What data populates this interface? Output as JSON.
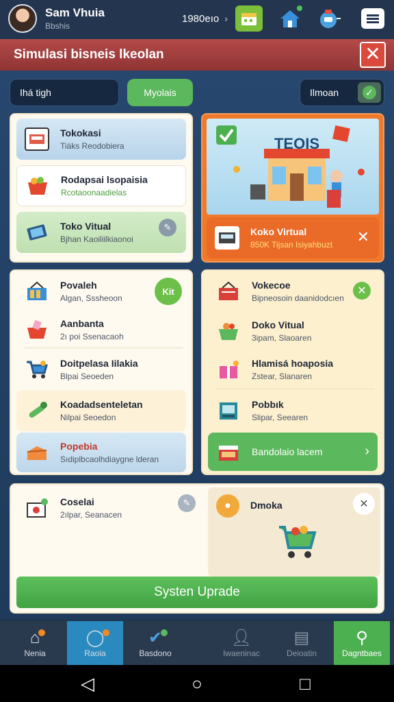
{
  "header": {
    "user_name": "Sam Vhuia",
    "user_sub": "Bbshis",
    "balance": "1980eıo",
    "icons": [
      "calendar-icon",
      "home-icon",
      "robot-icon",
      "menu-icon"
    ]
  },
  "title_bar": {
    "title": "Simulasi bisneis lkeolan",
    "close_label": "✕"
  },
  "filters": {
    "search_value": "Ihá tigh",
    "tab_active": "Myolais",
    "right_label": "Ilmoan"
  },
  "left_top_list": [
    {
      "title": "Tokokasi",
      "subtitle": "Tiáks Reodobiera",
      "icon": "shop-register-icon"
    },
    {
      "title": "Rodapsai lsopaisia",
      "subtitle": "Rcotaoonaadielas",
      "icon": "basket-icon"
    },
    {
      "title": "Toko Vitual",
      "subtitle": "Bjhan Kaoiliilkiaonoi",
      "icon": "tablet-icon"
    }
  ],
  "feature_card": {
    "banner_text": "TEOIS",
    "title": "Koko Virtual",
    "subtitle": "850K Tijsan Isiyahbuzt",
    "accent": "#f07a2c"
  },
  "left_middle_list": [
    {
      "title": "Povaleh",
      "subtitle": "Algan, Sssheoon",
      "icon": "crate-icon",
      "badge": "Kit"
    },
    {
      "title": "Aanbanta",
      "subtitle": "2ı poi Ssenacaoh",
      "icon": "fruit-basket-icon"
    },
    {
      "title": "Doitpelasa Iilakia",
      "subtitle": "Blpai Seoeden",
      "icon": "cart-icon"
    },
    {
      "title": "Koadadsenteletan",
      "subtitle": "Nilpai Seoedon",
      "icon": "wrench-icon"
    },
    {
      "title": "Popebia",
      "subtitle": "Sıdiplbcaolhdiaygne lderan",
      "icon": "box-icon"
    }
  ],
  "right_middle_list": [
    {
      "title": "Vokecoe",
      "subtitle": "Bipneosoin daanidodcıen",
      "icon": "crate-red-icon"
    },
    {
      "title": "Doko Vitual",
      "subtitle": "3ipam, Slaoaren",
      "icon": "basket-green-icon"
    },
    {
      "title": "Hlamisá hoaposia",
      "subtitle": "Zstear, Slanaren",
      "icon": "gift-box-icon"
    },
    {
      "title": "Pobbık",
      "subtitle": "Slipar, Seearen",
      "icon": "machine-icon"
    }
  ],
  "right_middle_action": "Bandolaio lacem",
  "bottom_card": {
    "left_title": "Coselai",
    "left_subtitle": "2ılpar, Seanacen",
    "right_title": "Dmoka",
    "upgrade_label": "Systen Uprade"
  },
  "bottom_nav": [
    {
      "label": "Nenia",
      "icon": "house-icon"
    },
    {
      "label": "Raoia",
      "icon": "ring-icon"
    },
    {
      "label": "Basdono",
      "icon": "check-icon"
    },
    {
      "label": "Iwaeninac",
      "icon": "person-icon"
    },
    {
      "label": "Deioatin",
      "icon": "document-icon"
    },
    {
      "label": "Dagntbaes",
      "icon": "search-icon"
    }
  ],
  "colors": {
    "green": "#4caf50",
    "orange": "#f07a2c",
    "navy": "#24364f",
    "red": "#b44a4a"
  }
}
